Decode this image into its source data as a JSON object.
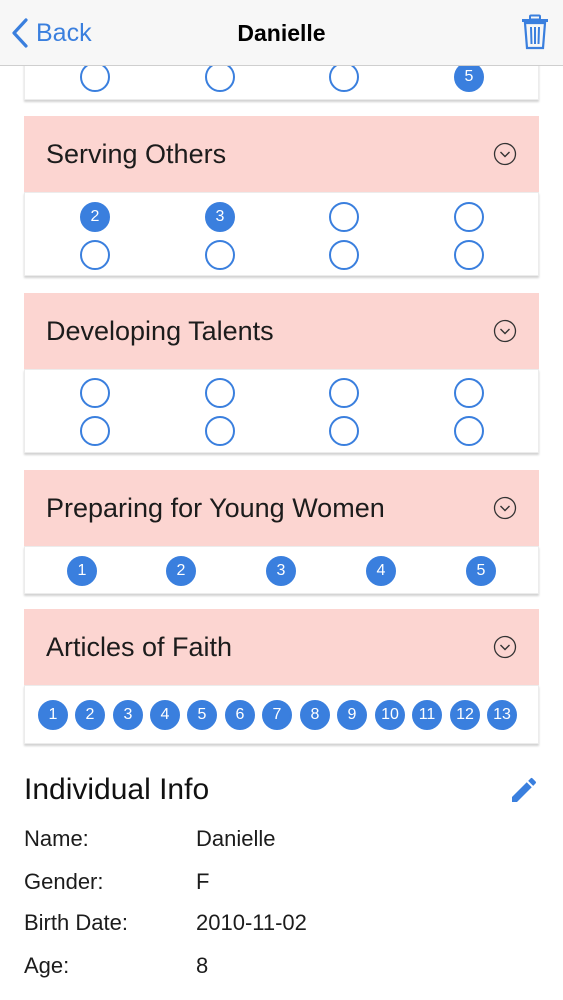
{
  "nav": {
    "back_label": "Back",
    "title": "Danielle"
  },
  "colors": {
    "accent": "#3a7fde",
    "header_bg": "#fcd5d1"
  },
  "top_partial": {
    "filled": [
      null,
      null,
      null,
      "5"
    ]
  },
  "sections": [
    {
      "title": "Serving Others",
      "rows": [
        [
          "2",
          "3",
          null,
          null
        ],
        [
          null,
          null,
          null,
          null
        ]
      ]
    },
    {
      "title": "Developing Talents",
      "rows": [
        [
          null,
          null,
          null,
          null
        ],
        [
          null,
          null,
          null,
          null
        ]
      ]
    },
    {
      "title": "Preparing for Young Women",
      "rows": [
        [
          "1",
          "2",
          "3",
          "4",
          "5"
        ]
      ]
    },
    {
      "title": "Articles of Faith",
      "rows": [
        [
          "1",
          "2",
          "3",
          "4",
          "5",
          "6",
          "7",
          "8",
          "9",
          "10",
          "11",
          "12",
          "13"
        ]
      ]
    }
  ],
  "info": {
    "title": "Individual Info",
    "fields": [
      {
        "label": "Name:",
        "value": "Danielle"
      },
      {
        "label": "Gender:",
        "value": "F"
      },
      {
        "label": "Birth Date:",
        "value": "2010-11-02"
      },
      {
        "label": "Age:",
        "value": "8"
      }
    ]
  }
}
